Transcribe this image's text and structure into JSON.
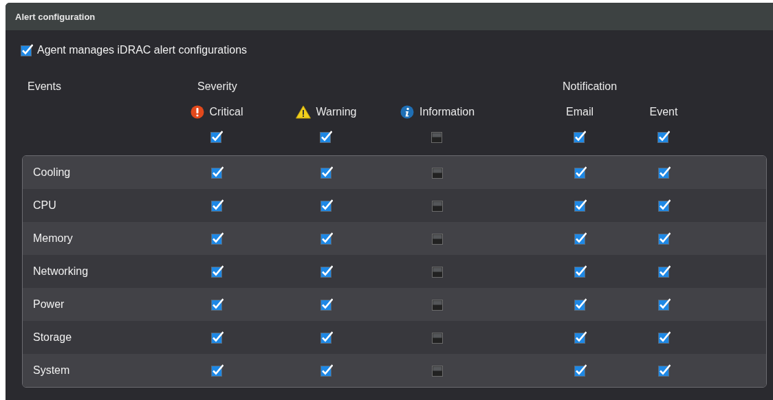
{
  "panel": {
    "title": "Alert configuration"
  },
  "agent_option": {
    "label": "Agent manages iDRAC alert configurations",
    "checked": true
  },
  "events_heading": "Events",
  "severity_heading": "Severity",
  "notification_heading": "Notification",
  "columns": [
    {
      "label": "Critical",
      "kind": "critical",
      "checked": true
    },
    {
      "label": "Warning",
      "kind": "warning",
      "checked": true
    },
    {
      "label": "Information",
      "kind": "information",
      "checked": false
    },
    {
      "label": "Email",
      "kind": "plain",
      "checked": true
    },
    {
      "label": "Event",
      "kind": "plain",
      "checked": true
    }
  ],
  "rows": [
    {
      "name": "Cooling",
      "checks": [
        true,
        true,
        false,
        true,
        true
      ]
    },
    {
      "name": "CPU",
      "checks": [
        true,
        true,
        false,
        true,
        true
      ]
    },
    {
      "name": "Memory",
      "checks": [
        true,
        true,
        false,
        true,
        true
      ]
    },
    {
      "name": "Networking",
      "checks": [
        true,
        true,
        false,
        true,
        true
      ]
    },
    {
      "name": "Power",
      "checks": [
        true,
        true,
        false,
        true,
        true
      ]
    },
    {
      "name": "Storage",
      "checks": [
        true,
        true,
        false,
        true,
        true
      ]
    },
    {
      "name": "System",
      "checks": [
        true,
        true,
        false,
        true,
        true
      ]
    }
  ]
}
